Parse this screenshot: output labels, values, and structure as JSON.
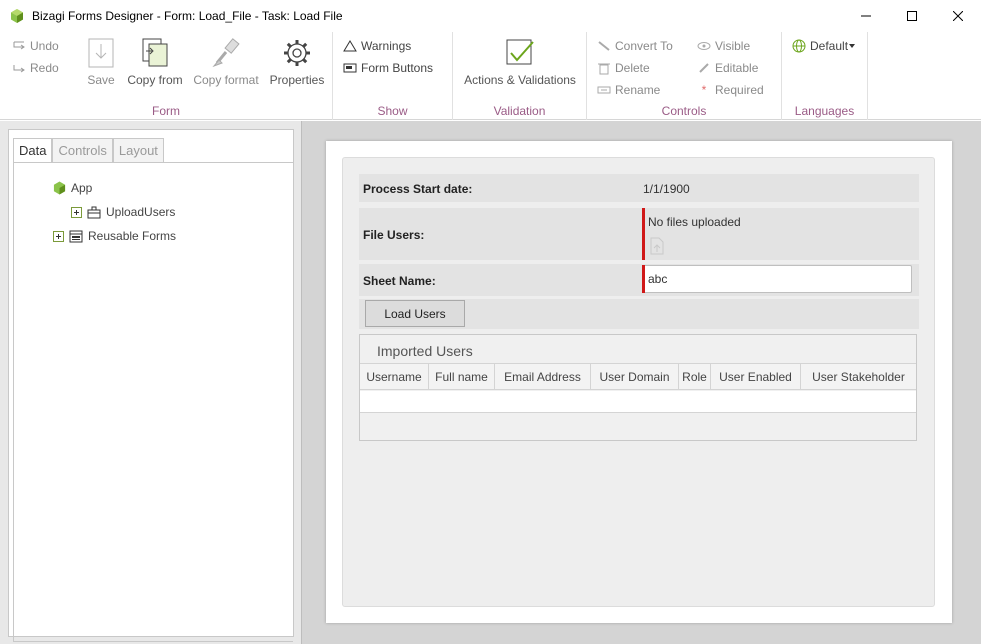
{
  "window": {
    "title": "Bizagi Forms Designer  - Form: Load_File - Task:  Load File",
    "brand_color": "#7ab51d"
  },
  "ribbon": {
    "form_group": {
      "label": "Form",
      "undo": "Undo",
      "redo": "Redo",
      "save": "Save",
      "copy_from": "Copy from",
      "copy_format": "Copy format",
      "properties": "Properties"
    },
    "show_group": {
      "label": "Show",
      "warnings": "Warnings",
      "form_buttons": "Form Buttons"
    },
    "validation_group": {
      "label": "Validation",
      "actions": "Actions & Validations"
    },
    "controls_group": {
      "label": "Controls",
      "convert_to": "Convert To",
      "delete": "Delete",
      "rename": "Rename",
      "visible": "Visible",
      "editable": "Editable",
      "required": "Required"
    },
    "languages_group": {
      "label": "Languages",
      "language": "Default"
    },
    "accent_color": "#9a5b86"
  },
  "left_panel": {
    "tabs": [
      "Data",
      "Controls",
      "Layout"
    ],
    "active_tab": "Data",
    "tree": {
      "root": "App",
      "child": "UploadUsers",
      "reusable": "Reusable Forms"
    }
  },
  "form": {
    "process_start_label": "Process Start date:",
    "process_start_value": "1/1/1900",
    "file_users_label": "File Users:",
    "file_users_value": "No files uploaded",
    "sheet_name_label": "Sheet Name:",
    "sheet_name_value": "abc",
    "load_button": "Load Users",
    "grid": {
      "title": "Imported Users",
      "columns": [
        "Username",
        "Full name",
        "Email Address",
        "User Domain",
        "Role",
        "User Enabled",
        "User Stakeholder"
      ]
    },
    "required_color": "#d01818"
  }
}
